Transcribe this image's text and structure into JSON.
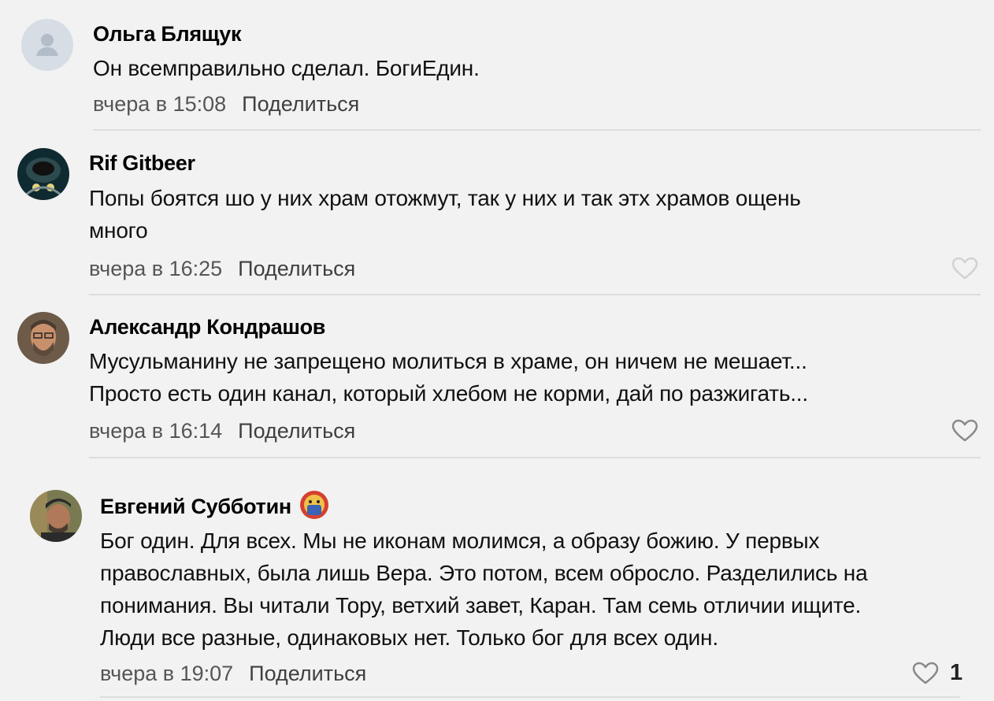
{
  "share_label": "Поделиться",
  "comments": [
    {
      "author": "Ольга Блящук",
      "text_lines": [
        "Он всемправильно сделал. БогиЕдин."
      ],
      "time": "вчера в 15:08",
      "avatar": "default-user-icon"
    },
    {
      "author": "Rif Gitbeer",
      "text_lines": [
        "Попы боятся шо у них храм отожмут, так у них и так этх храмов ощень",
        "много"
      ],
      "time": "вчера в 16:25",
      "avatar": "photo"
    },
    {
      "author": "Александр Кондрашов",
      "text_lines": [
        "Мусульманину не запрещено молиться в храме, он ничем не мешает...",
        "Просто есть один канал, который хлебом не корми, дай по разжигать..."
      ],
      "time": "вчера в 16:14",
      "avatar": "photo"
    },
    {
      "author": "Евгений Субботин",
      "text_lines": [
        "Бог один. Для всех. Мы не иконам молимся, а образу божию. У первых",
        "православных, была лишь Вера. Это потом, всем обросло. Разделились на",
        "понимания. Вы читали Тору, ветхий завет, Каран. Там семь отличии ищите.",
        "Люди все разные, одинаковых нет. Только бог для всех один."
      ],
      "time": "вчера в 19:07",
      "avatar": "photo",
      "like_count": "1",
      "badge": "emoji-badge"
    }
  ],
  "colors": {
    "background": "#f2f2f2",
    "meta_text": "#5b5b5b",
    "divider": "#dcdcdc",
    "heart": "#8a8a8a"
  }
}
